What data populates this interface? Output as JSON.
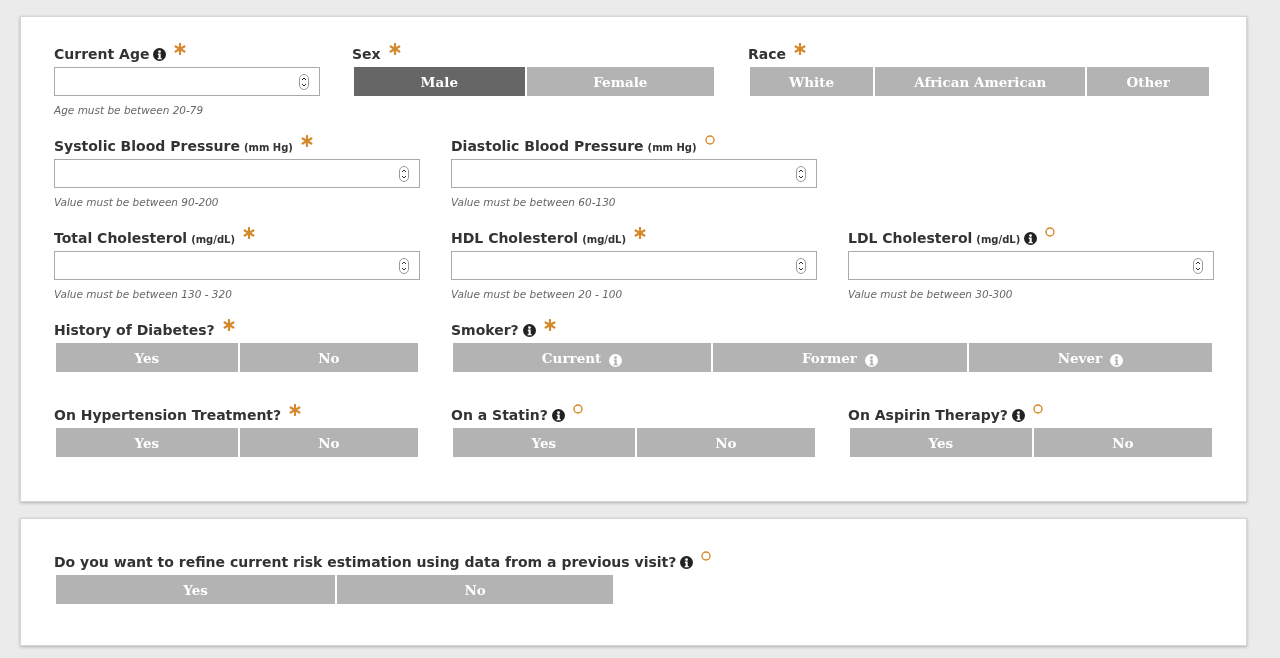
{
  "sections": [
    {
      "kind": "main",
      "rows": [
        {
          "kind": "first",
          "fields": [
            {
              "kind": "number",
              "label": "Current Age",
              "info": true,
              "required": true,
              "hint": "Age must be between 20-79"
            },
            {
              "kind": "segmented",
              "label": "Sex",
              "info": false,
              "required": true,
              "options": [
                {
                  "label": "Male",
                  "selected": true,
                  "info": false
                },
                {
                  "label": "Female",
                  "selected": false,
                  "info": false
                }
              ]
            },
            {
              "kind": "segmented",
              "label": "Race",
              "info": false,
              "required": true,
              "options": [
                {
                  "label": "White",
                  "selected": false,
                  "info": false
                },
                {
                  "label": "African American",
                  "selected": false,
                  "info": false
                },
                {
                  "label": "Other",
                  "selected": false,
                  "info": false
                }
              ]
            }
          ]
        },
        {
          "kind": "standard",
          "fields": [
            {
              "kind": "number",
              "label": "Systolic Blood Pressure",
              "unit": "(mm Hg)",
              "info": false,
              "required": true,
              "hint": "Value must be between 90-200"
            },
            {
              "kind": "number",
              "label": "Diastolic Blood Pressure",
              "unit": "(mm Hg)",
              "info": false,
              "required": false,
              "hint": "Value must be between 60-130"
            }
          ]
        },
        {
          "kind": "standard",
          "fields": [
            {
              "kind": "number",
              "label": "Total Cholesterol",
              "unit": "(mg/dL)",
              "info": false,
              "required": true,
              "hint": "Value must be between 130 - 320"
            },
            {
              "kind": "number",
              "label": "HDL Cholesterol",
              "unit": "(mg/dL)",
              "info": false,
              "required": true,
              "hint": "Value must be between 20 - 100"
            },
            {
              "kind": "number",
              "label": "LDL Cholesterol",
              "unit": "(mg/dL)",
              "info": true,
              "required": false,
              "hint": "Value must be between 30-300"
            }
          ]
        },
        {
          "kind": "standard",
          "fields": [
            {
              "kind": "segmented",
              "label": "History of Diabetes?",
              "info": false,
              "required": true,
              "options": [
                {
                  "label": "Yes",
                  "selected": false,
                  "info": false
                },
                {
                  "label": "No",
                  "selected": false,
                  "info": false
                }
              ]
            },
            {
              "kind": "segmented-wide",
              "label": "Smoker?",
              "info": true,
              "required": true,
              "options": [
                {
                  "label": "Current",
                  "selected": false,
                  "info": true
                },
                {
                  "label": "Former",
                  "selected": false,
                  "info": true
                },
                {
                  "label": "Never",
                  "selected": false,
                  "info": true
                }
              ]
            }
          ]
        },
        {
          "kind": "standard",
          "fields": [
            {
              "kind": "segmented",
              "label": "On Hypertension Treatment?",
              "info": false,
              "required": true,
              "options": [
                {
                  "label": "Yes",
                  "selected": false,
                  "info": false
                },
                {
                  "label": "No",
                  "selected": false,
                  "info": false
                }
              ]
            },
            {
              "kind": "segmented",
              "label": "On a Statin?",
              "info": true,
              "required": false,
              "options": [
                {
                  "label": "Yes",
                  "selected": false,
                  "info": false
                },
                {
                  "label": "No",
                  "selected": false,
                  "info": false
                }
              ]
            },
            {
              "kind": "segmented",
              "label": "On Aspirin Therapy?",
              "info": true,
              "required": false,
              "options": [
                {
                  "label": "Yes",
                  "selected": false,
                  "info": false
                },
                {
                  "label": "No",
                  "selected": false,
                  "info": false
                }
              ]
            }
          ]
        }
      ]
    },
    {
      "kind": "refine",
      "rows": [
        {
          "kind": "single",
          "fields": [
            {
              "kind": "segmented",
              "label": "Do you want to refine current risk estimation using data from a previous visit?",
              "info": true,
              "required": false,
              "options": [
                {
                  "label": "Yes",
                  "selected": false,
                  "info": false
                },
                {
                  "label": "No",
                  "selected": false,
                  "info": false
                }
              ]
            }
          ]
        }
      ]
    }
  ]
}
